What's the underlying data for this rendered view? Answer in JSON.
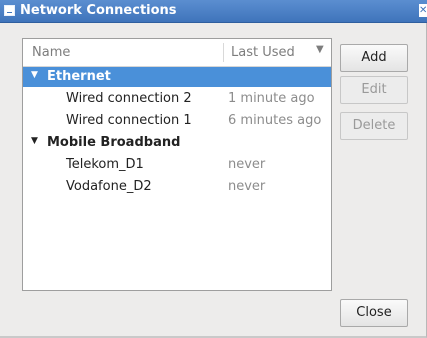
{
  "window": {
    "title": "Network Connections"
  },
  "list": {
    "columns": {
      "name": "Name",
      "last_used": "Last Used"
    },
    "rows": [
      {
        "name": "Ethernet",
        "last_used": "",
        "type": "group",
        "selected": true
      },
      {
        "name": "Wired connection 2",
        "last_used": "1 minute ago",
        "type": "item"
      },
      {
        "name": "Wired connection 1",
        "last_used": "6 minutes ago",
        "type": "item"
      },
      {
        "name": "Mobile Broadband",
        "last_used": "",
        "type": "group"
      },
      {
        "name": "Telekom_D1",
        "last_used": "never",
        "type": "item"
      },
      {
        "name": "Vodafone_D2",
        "last_used": "never",
        "type": "item"
      }
    ]
  },
  "buttons": {
    "add": "Add",
    "edit": "Edit",
    "delete": "Delete",
    "close": "Close"
  },
  "colors": {
    "titlebar": "#4a82c8",
    "selection": "#4a90d9"
  }
}
